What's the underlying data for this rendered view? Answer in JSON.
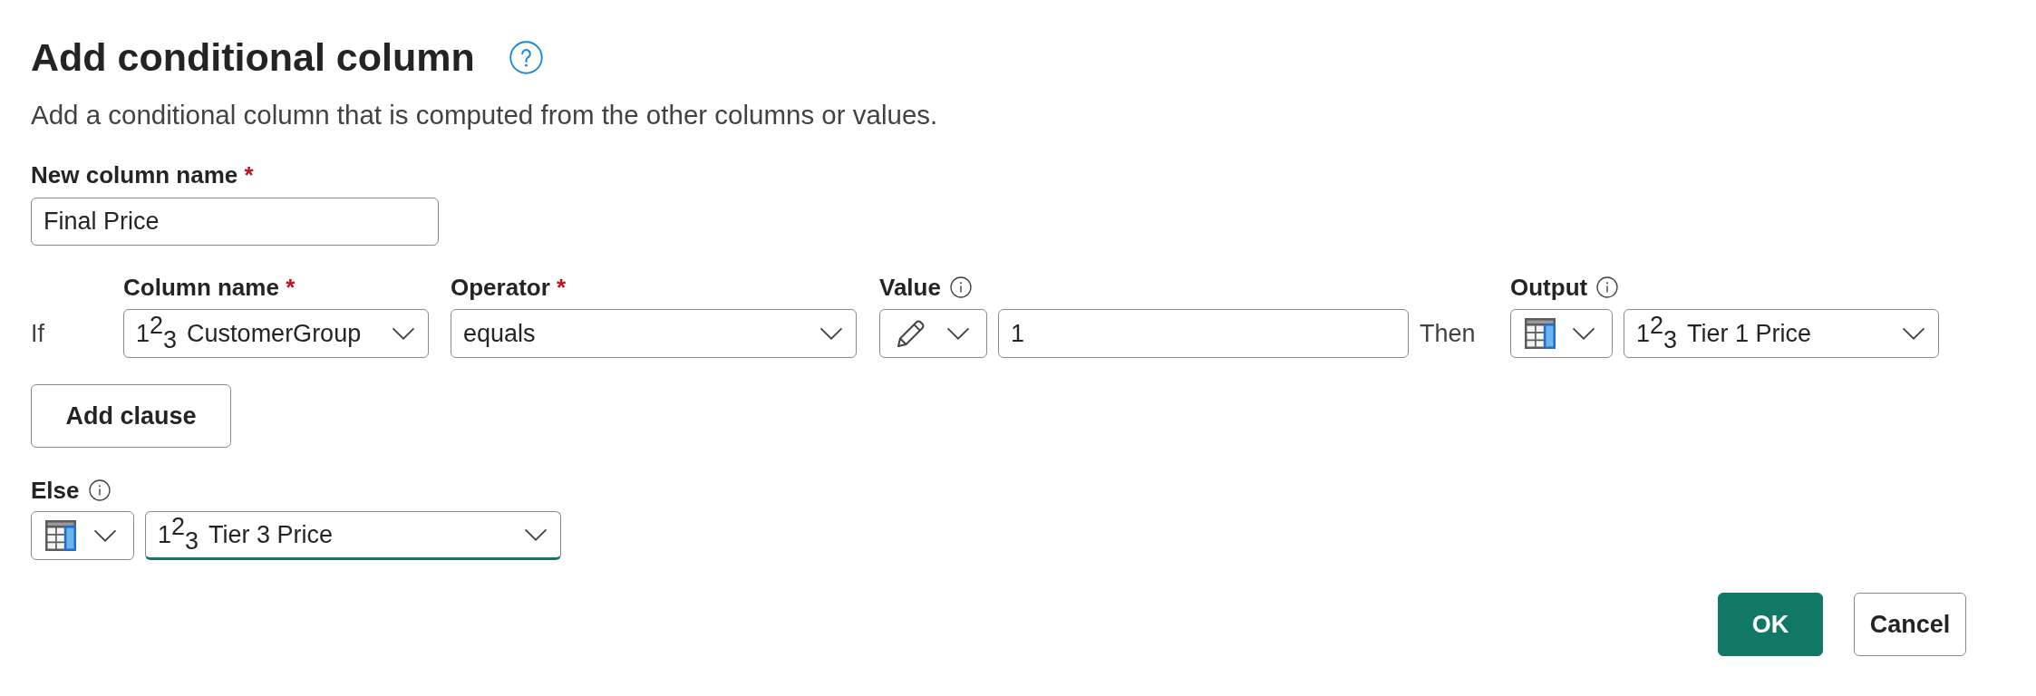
{
  "dialog": {
    "title": "Add conditional column",
    "help": true,
    "description": "Add a conditional column that is computed from the other columns or values."
  },
  "new_column": {
    "label": "New column name",
    "required_mark": "*",
    "value": "Final Price"
  },
  "clauses": [
    {
      "if_label": "If",
      "then_label": "Then",
      "column": {
        "label": "Column name",
        "required_mark": "*",
        "type_marker": "1$^{2}$$_{3}$",
        "value": "CustomerGroup"
      },
      "operator": {
        "label": "Operator",
        "required_mark": "*",
        "value": "equals"
      },
      "value": {
        "label": "Value",
        "info": true,
        "kind": "value",
        "text": "1"
      },
      "output": {
        "label": "Output",
        "info": true,
        "kind": "column",
        "type_marker": "1$^{2}$$_{3}$",
        "value": "Tier 1 Price"
      }
    }
  ],
  "add_clause": {
    "label": "Add clause"
  },
  "else": {
    "label": "Else",
    "info": true,
    "kind": "column",
    "type_marker": "1$^{2}$$_{3}$",
    "value": "Tier 3 Price",
    "focused": true
  },
  "buttons": [
    {
      "label": "OK",
      "primary": true
    },
    {
      "label": "Cancel",
      "primary": false
    }
  ]
}
